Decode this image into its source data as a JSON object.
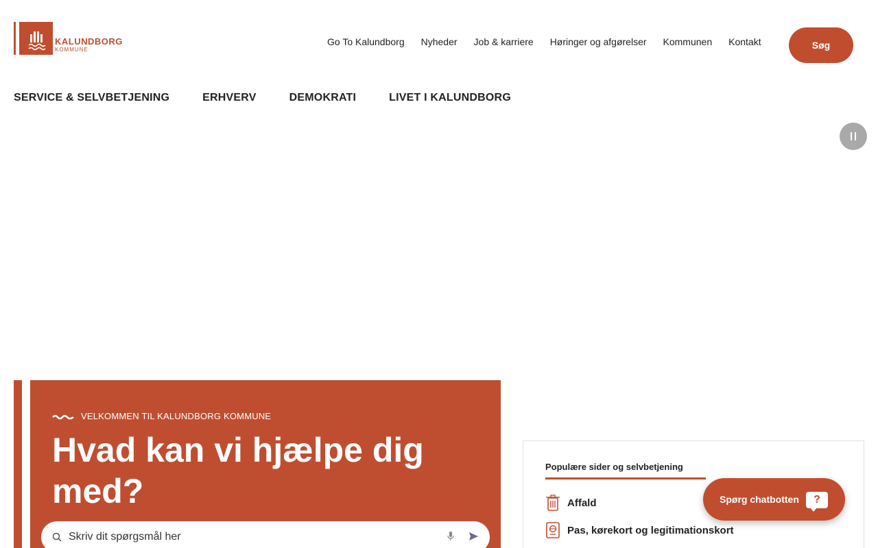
{
  "logo": {
    "name": "KALUNDBORG",
    "sub": "KOMMUNE"
  },
  "topnav": {
    "items": [
      "Go To Kalundborg",
      "Nyheder",
      "Job & karriere",
      "Høringer og afgørelser",
      "Kommunen",
      "Kontakt"
    ]
  },
  "search_button": "Søg",
  "mainnav": {
    "items": [
      "SERVICE & SELVBETJENING",
      "ERHVERV",
      "DEMOKRATI",
      "LIVET I KALUNDBORG"
    ]
  },
  "hero": {
    "kicker": "VELKOMMEN TIL KALUNDBORG KOMMUNE",
    "title": "Hvad kan vi hjælpe dig med?",
    "search_placeholder": "Skriv dit spørgsmål her"
  },
  "popular": {
    "title": "Populære sider og selvbetjening",
    "items": [
      "Affald",
      "Pas, kørekort og legitimationskort"
    ]
  },
  "chatbot": {
    "label": "Spørg chatbotten",
    "icon": "?"
  },
  "colors": {
    "brand": "#c14d2f",
    "pause": "#a9a9a9"
  },
  "icons": [
    "pause-icon",
    "wave-icon",
    "search-icon",
    "mic-icon",
    "send-icon",
    "trash-icon",
    "passport-icon",
    "chat-question-icon"
  ]
}
